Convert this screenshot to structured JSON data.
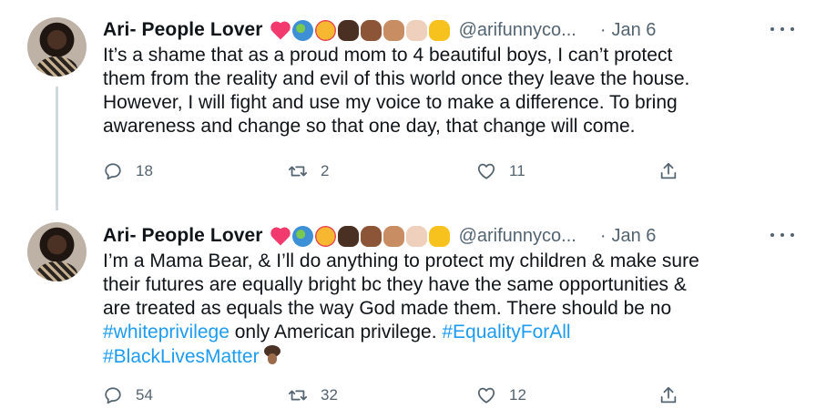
{
  "tweets": [
    {
      "display_name": "Ari- People Lover",
      "emoji_icons": [
        "heart",
        "globe",
        "smiling-face-with-hearts",
        "fist-dark",
        "fist-medium-dark",
        "fist-medium",
        "fist-light",
        "fist-yellow"
      ],
      "handle": "@arifunnyco...",
      "separator": "·",
      "date": "Jan 6",
      "text_lines": [
        "It’s a shame that as a proud mom to 4 beautiful boys, I can’t protect",
        "them from the reality and evil of this world once they leave the house.",
        "However, I will fight and use my voice to make a difference. To bring",
        "awareness and change so that one day, that change will come."
      ],
      "replies": "18",
      "retweets": "2",
      "likes": "11"
    },
    {
      "display_name": "Ari- People Lover",
      "emoji_icons": [
        "heart",
        "globe",
        "smiling-face-with-hearts",
        "fist-dark",
        "fist-medium-dark",
        "fist-medium",
        "fist-light",
        "fist-yellow"
      ],
      "handle": "@arifunnyco...",
      "separator": "·",
      "date": "Jan 6",
      "text_lines": [
        "I’m a Mama Bear, & I’ll do anything to protect my children & make sure",
        "their futures are equally bright bc they have the same opportunities &",
        "are treated as equals the way God made them. There should be no"
      ],
      "line4_hashtag_1": "#whiteprivilege",
      "line4_middle": " only American privilege. ",
      "line4_hashtag_2": "#EqualityForAll",
      "line5_hashtag": "#BlackLivesMatter",
      "replies": "54",
      "retweets": "32",
      "likes": "12"
    }
  ],
  "colors": {
    "text": "#0f1419",
    "secondary": "#536471",
    "link": "#1d9bf0",
    "thread_line": "#cfd9de"
  }
}
